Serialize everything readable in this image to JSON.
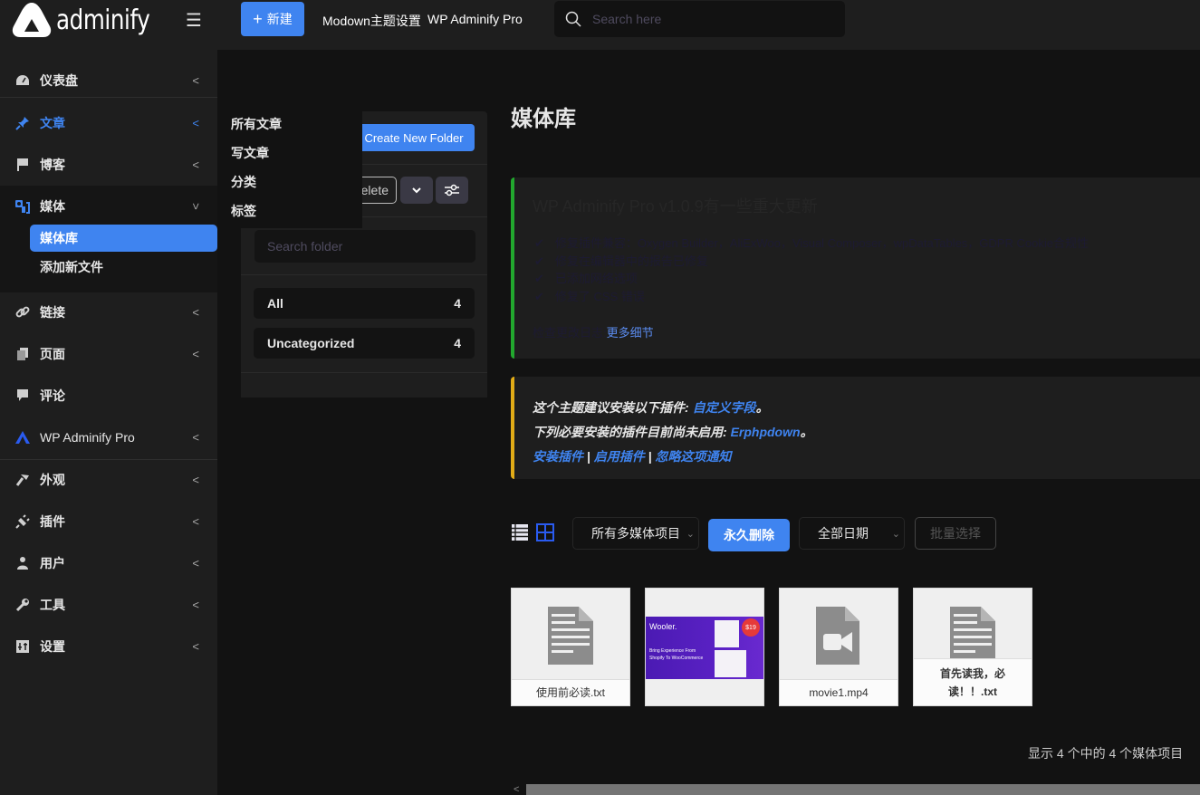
{
  "topbar": {
    "logo_text": "adminify",
    "new_label": "新建",
    "links": [
      "Modown主题设置",
      "WP Adminify Pro"
    ],
    "search_placeholder": "Search here"
  },
  "sidebar": {
    "items": [
      {
        "label": "仪表盘",
        "icon": "dashboard-icon"
      },
      {
        "label": "文章",
        "icon": "pin-icon",
        "active": true
      },
      {
        "label": "博客",
        "icon": "flag-icon"
      },
      {
        "label": "媒体",
        "icon": "media-icon",
        "expanded": true
      },
      {
        "label": "链接",
        "icon": "link-icon"
      },
      {
        "label": "页面",
        "icon": "pages-icon"
      },
      {
        "label": "评论",
        "icon": "comment-icon"
      },
      {
        "label": "WP Adminify Pro",
        "icon": "adminify-icon"
      },
      {
        "label": "外观",
        "icon": "brush-icon"
      },
      {
        "label": "插件",
        "icon": "plugin-icon"
      },
      {
        "label": "用户",
        "icon": "user-icon"
      },
      {
        "label": "工具",
        "icon": "wrench-icon"
      },
      {
        "label": "设置",
        "icon": "settings-icon"
      }
    ],
    "media_sub": [
      {
        "label": "媒体库",
        "selected": true
      },
      {
        "label": "添加新文件"
      }
    ]
  },
  "flyout": {
    "items": [
      "所有文章",
      "写文章",
      "分类",
      "标签"
    ]
  },
  "folders": {
    "create_label": "Create New Folder",
    "delete_label": "elete",
    "search_placeholder": "Search folder",
    "list": [
      {
        "name": "All",
        "count": "4"
      },
      {
        "name": "Uncategorized",
        "count": "4"
      }
    ]
  },
  "main": {
    "title": "媒体库",
    "update_notice": {
      "title": "WP Adminify Pro v1.0.9有一些重大更新",
      "bullets": [
        "修复插件兼容：Oxygen Builder，AliExWoo，Visual Composer，wpDataTables，GDPR Cookie合规性",
        "修复在编辑器中的报告已修复",
        "已添加网络选项",
        "修复了 CSS 错误"
      ],
      "footer_text": "检查更改日志:",
      "footer_link": "更多细节"
    },
    "plugin_notice": {
      "line1_text": "这个主题建议安装以下插件: ",
      "line1_link": "自定义字段",
      "line1_end": "。",
      "line2_text": "下列必要安装的插件目前尚未启用: ",
      "line2_link": "Erphpdown",
      "line2_end": "。",
      "actions": [
        "安装插件",
        "启用插件",
        "忽略这项通知"
      ],
      "separator": " | "
    },
    "toolbar": {
      "media_type": "所有多媒体项目",
      "perm_delete": "永久删除",
      "date_filter": "全部日期",
      "bulk_select": "批量选择"
    },
    "media": [
      {
        "name": "使用前必读.txt",
        "type": "document"
      },
      {
        "name": "",
        "type": "image",
        "thumb_text": "Wooler.",
        "thumb_sub": "Bring Experience From Shopify To WooCommerce",
        "badge": "$19"
      },
      {
        "name": "movie1.mp4",
        "type": "video"
      },
      {
        "name": "首先读我，必读！！.txt",
        "type": "document"
      }
    ],
    "count_text": "显示 4 个中的 4 个媒体项目"
  },
  "colors": {
    "accent": "#3f84f0",
    "success": "#22a82e",
    "warning": "#e2ac17"
  }
}
